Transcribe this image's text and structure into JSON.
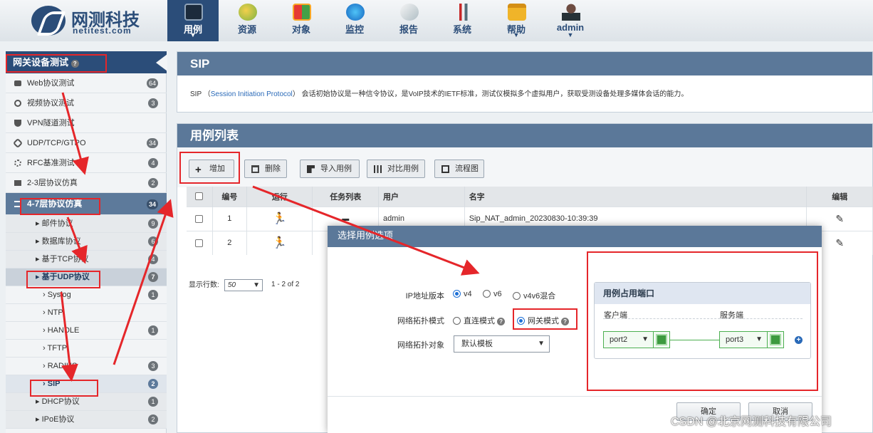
{
  "brand": {
    "name_cn": "网测科技",
    "name_en": "netitest.com"
  },
  "nav": [
    {
      "label": "用例",
      "icon": "monitor-icon",
      "active": true
    },
    {
      "label": "资源",
      "icon": "resource-icon"
    },
    {
      "label": "对象",
      "icon": "object-icon"
    },
    {
      "label": "监控",
      "icon": "globe-icon"
    },
    {
      "label": "报告",
      "icon": "report-icon"
    },
    {
      "label": "系统",
      "icon": "tools-icon"
    },
    {
      "label": "帮助",
      "icon": "folder-icon"
    },
    {
      "label": "admin",
      "icon": "user-icon"
    }
  ],
  "sidebar": {
    "header": "网关设备测试",
    "items": [
      {
        "label": "Web协议测试",
        "badge": "64",
        "level": 1
      },
      {
        "label": "视频协议测试",
        "badge": "3",
        "level": 1
      },
      {
        "label": "VPN隧道测试",
        "badge": "",
        "level": 1
      },
      {
        "label": "UDP/TCP/GTPO",
        "badge": "34",
        "level": 1
      },
      {
        "label": "RFC基准测试",
        "badge": "4",
        "level": 1
      },
      {
        "label": "2-3层协议仿真",
        "badge": "2",
        "level": 1
      },
      {
        "label": "4-7层协议仿真",
        "badge": "34",
        "level": 1,
        "highlight": true
      },
      {
        "label": "邮件协议",
        "badge": "9",
        "level": 2
      },
      {
        "label": "数据库协议",
        "badge": "6",
        "level": 2
      },
      {
        "label": "基于TCP协议",
        "badge": "4",
        "level": 2
      },
      {
        "label": "基于UDP协议",
        "badge": "7",
        "level": 2
      },
      {
        "label": "Syslog",
        "badge": "1",
        "level": 3
      },
      {
        "label": "NTP",
        "badge": "",
        "level": 3
      },
      {
        "label": "HANDLE",
        "badge": "1",
        "level": 3
      },
      {
        "label": "TFTP",
        "badge": "",
        "level": 3
      },
      {
        "label": "RADIUS",
        "badge": "3",
        "level": 3
      },
      {
        "label": "SIP",
        "badge": "2",
        "level": 3,
        "selected": true
      },
      {
        "label": "DHCP协议",
        "badge": "1",
        "level": 2
      },
      {
        "label": "IPoE协议",
        "badge": "2",
        "level": 2
      }
    ]
  },
  "sip_panel": {
    "title": "SIP",
    "desc_prefix": "SIP （",
    "desc_link": "Session Initiation Protocol",
    "desc_suffix": "） 会话初始协议是一种信令协议，是VoIP技术的IETF标准，测试仪模拟多个虚拟用户，获取受测设备处理多媒体会话的能力。"
  },
  "case_list": {
    "title": "用例列表",
    "buttons": {
      "add": "增加",
      "delete": "删除",
      "import": "导入用例",
      "compare": "对比用例",
      "flow": "流程图"
    },
    "columns": [
      "编号",
      "运行",
      "任务列表",
      "用户",
      "名字",
      "编辑"
    ],
    "rows": [
      {
        "id": "1",
        "user": "admin",
        "name": "Sip_NAT_admin_20230830-10:39:39"
      },
      {
        "id": "2",
        "user": "",
        "name": ""
      }
    ],
    "rows_label": "显示行数:",
    "rows_value": "50",
    "range": "1 - 2 of 2"
  },
  "modal": {
    "title": "选择用例选项",
    "ip_label": "IP地址版本",
    "ip_options": [
      "v4",
      "v6",
      "v4v6混合"
    ],
    "ip_selected": "v4",
    "topo_mode_label": "网络拓扑模式",
    "topo_modes": [
      "直连模式",
      "网关模式"
    ],
    "topo_selected": "网关模式",
    "topo_obj_label": "网络拓扑对象",
    "topo_obj_value": "默认模板",
    "ports_title": "用例占用端口",
    "client_label": "客户端",
    "server_label": "服务端",
    "client_port": "port2",
    "server_port": "port3",
    "ok": "确定",
    "cancel": "取消"
  },
  "watermark": "CSDN @北京网测科技有限公司"
}
